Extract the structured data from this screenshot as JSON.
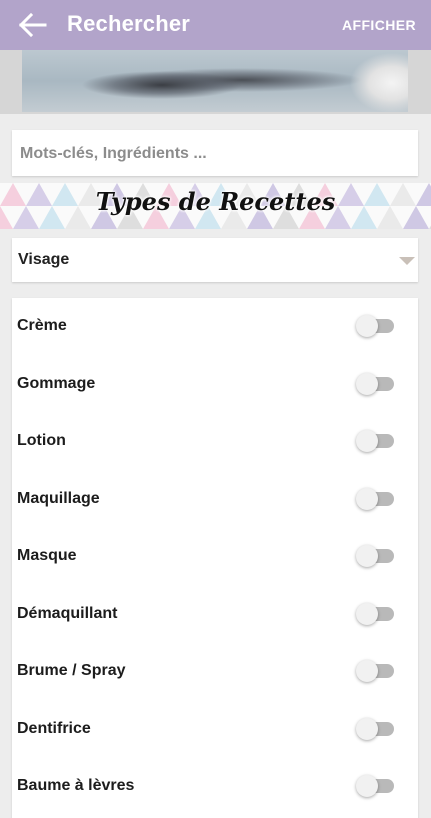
{
  "appbar": {
    "title": "Rechercher",
    "action_label": "AFFICHER",
    "back_icon": "arrow-left-icon",
    "color": "#b2a4ca"
  },
  "search": {
    "placeholder": "Mots-clés, Ingrédients ...",
    "value": ""
  },
  "types_section": {
    "title": "Types de Recettes"
  },
  "category_select": {
    "selected": "Visage"
  },
  "recipe_types": [
    {
      "label": "Crème",
      "enabled": false
    },
    {
      "label": "Gommage",
      "enabled": false
    },
    {
      "label": "Lotion",
      "enabled": false
    },
    {
      "label": "Maquillage",
      "enabled": false
    },
    {
      "label": "Masque",
      "enabled": false
    },
    {
      "label": "Démaquillant",
      "enabled": false
    },
    {
      "label": "Brume / Spray",
      "enabled": false
    },
    {
      "label": "Dentifrice",
      "enabled": false
    },
    {
      "label": "Baume à lèvres",
      "enabled": false
    }
  ]
}
